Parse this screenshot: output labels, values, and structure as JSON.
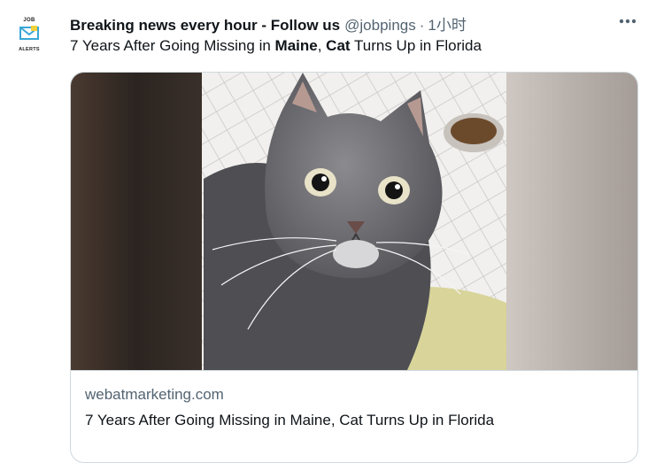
{
  "account": {
    "display_name": "Breaking news every hour - Follow us",
    "handle": "@jobpings",
    "separator": "·",
    "time": "1小时",
    "avatar": {
      "line1": "JOB",
      "line2": "ALERTS",
      "icon": "mail-icon"
    }
  },
  "tweet": {
    "text_part1": "7 Years After Going Missing in ",
    "text_bold1": "Maine",
    "text_part2": ", ",
    "text_bold2": "Cat",
    "text_part3": " Turns Up in Florida"
  },
  "menu": {
    "icon": "more-horizontal-icon"
  },
  "card": {
    "image_subject": "cat-photo",
    "domain": "webatmarketing.com",
    "title": "7 Years After Going Missing in Maine, Cat Turns Up in Florida"
  },
  "colors": {
    "text_primary": "#0f1419",
    "text_secondary": "#536471",
    "border": "#cfd9de",
    "avatar_accent": "#3aa6d6",
    "avatar_badge": "#f2d13a"
  }
}
